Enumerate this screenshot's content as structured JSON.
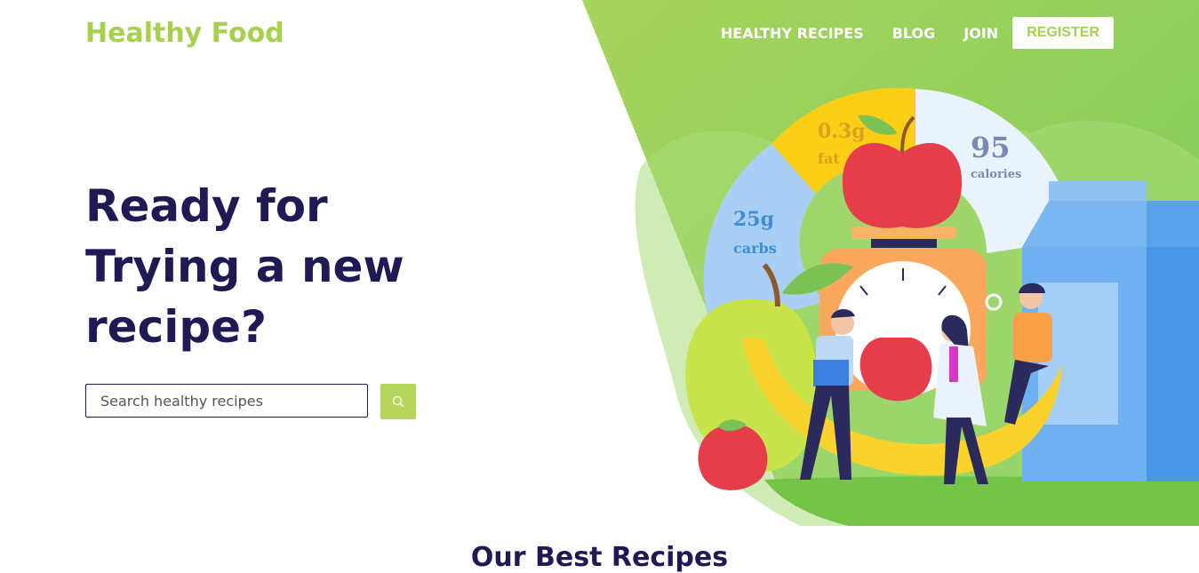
{
  "brand": {
    "name": "Healthy Food"
  },
  "nav": {
    "items": [
      {
        "label": "HEALTHY RECIPES"
      },
      {
        "label": "BLOG"
      },
      {
        "label": "JOIN"
      }
    ],
    "register_label": "REGISTER"
  },
  "hero": {
    "headline": "Ready for Trying a new recipe?",
    "search": {
      "placeholder": "Search healthy recipes",
      "value": ""
    },
    "search_button_icon": "search-icon",
    "nutrition": {
      "fat_value": "0.3g",
      "fat_label": "fat",
      "calories_value": "95",
      "calories_label": "calories",
      "carbs_value": "25g",
      "carbs_label": "carbs"
    }
  },
  "section": {
    "title": "Our Best Recipes"
  },
  "colors": {
    "brand_green": "#a8d04f",
    "hero_green": "#8ccf5b",
    "navy": "#1f1a54",
    "search_button": "#b5d55b"
  }
}
